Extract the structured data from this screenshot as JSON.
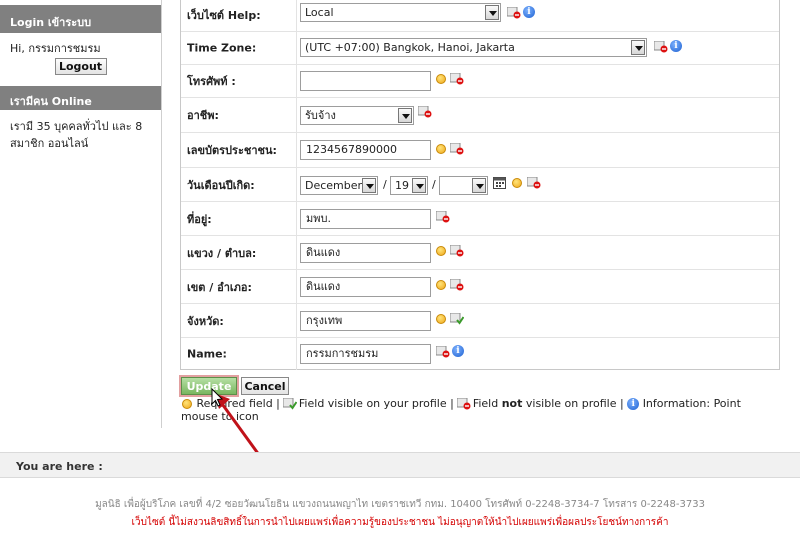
{
  "sidebar": {
    "login_title": "Login เข้าระบบ",
    "greeting": "Hi, กรรมการชมรม",
    "logout_label": "Logout",
    "online_title": "เรามีคน Online",
    "online_text": "เรามี 35 บุคคลทั่วไป และ 8 สมาชิก ออนไลน์"
  },
  "form": {
    "help_site": {
      "label": "เว็บไซต์ Help:",
      "value": "Local"
    },
    "timezone": {
      "label": "Time Zone:",
      "value": "(UTC +07:00) Bangkok, Hanoi, Jakarta"
    },
    "phone": {
      "label": "โทรศัพท์ :",
      "value": ""
    },
    "occupation": {
      "label": "อาชีพ:",
      "value": "รับจ้าง"
    },
    "id_number": {
      "label": "เลขบัตรประชาชน:",
      "value": "1234567890000"
    },
    "birthdate": {
      "label": "วันเดือนปีเกิด:",
      "month": "December",
      "day": "19",
      "year": "",
      "separator": "/"
    },
    "address": {
      "label": "ที่อยู่:",
      "value": "มพบ."
    },
    "subdistrict": {
      "label": "แขวง / ตำบล:",
      "value": "ดินแดง"
    },
    "district": {
      "label": "เขต / อำเภอ:",
      "value": "ดินแดง"
    },
    "province": {
      "label": "จังหวัด:",
      "value": "กรุงเทพ"
    },
    "name": {
      "label": "Name:",
      "value": "กรรมการชมรม"
    }
  },
  "buttons": {
    "update": "Update",
    "cancel": "Cancel"
  },
  "legend": {
    "required": "Required field |",
    "visible": "Field visible on your profile |",
    "not_visible_pre": "Field",
    "not_visible_bold": "not",
    "not_visible_post": "visible on profile |",
    "information": "Information: Point mouse to icon"
  },
  "breadcrumb": "You are here  :",
  "footer": {
    "address": "มูลนิธิ เพื่อผู้บริโภค เลขที่ 4/2 ซอยวัฒนโยธิน แขวงถนนพญาไท เขตราชเทวี กทม. 10400 โทรศัพท์ 0-2248-3734-7 โทรสาร 0-2248-3733",
    "notice": "เว็บไซต์ นี้ไม่สงวนลิขสิทธิ์ในการนำไปเผยแพร่เพื่อความรู้ของประชาชน ไม่อนุญาตให้นำไปเผยแพร่เพื่อผลประโยชน์ทางการค้า"
  },
  "icons": {
    "required": "required-sun-icon",
    "hidden": "field-hidden-icon",
    "visible": "field-visible-icon",
    "info": "info-icon",
    "calendar": "calendar-icon"
  },
  "colors": {
    "sidebar_header": "#808080",
    "update_button": "#79b660",
    "footer_notice": "#d40000",
    "annotation_arrow": "#c0121a"
  }
}
